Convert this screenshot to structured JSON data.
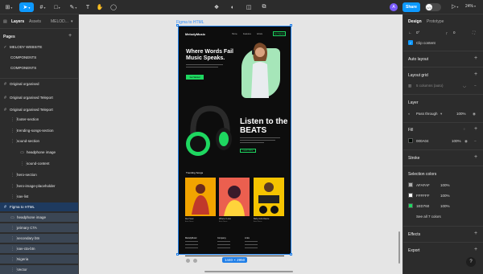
{
  "toolbar": {
    "avatar_initial": "A",
    "share_label": "Share",
    "devmode_icon": "</>",
    "zoom": "24%"
  },
  "left_panel": {
    "tabs": [
      "Layers",
      "Assets",
      "MELOD..."
    ],
    "pages_header": "Pages",
    "pages": [
      "MELODY WEBSITE",
      "COMPONENTS",
      "COMPONENTS"
    ],
    "layers": [
      {
        "label": "Original organised",
        "icon": "#"
      },
      {
        "label": "Original organised Teleport",
        "icon": "#"
      },
      {
        "label": "Original organised Teleport",
        "icon": "#"
      },
      {
        "label": "footer-section",
        "icon": "⋮⋮"
      },
      {
        "label": "trending-songs-section",
        "icon": "⋮⋮"
      },
      {
        "label": "sound-section",
        "icon": "⋮⋮"
      },
      {
        "label": "headphone image",
        "icon": "▭"
      },
      {
        "label": "sound-content",
        "icon": "⋮⋮"
      },
      {
        "label": "hero-section",
        "icon": "⋮⋮"
      },
      {
        "label": "hero-image-placeholder",
        "icon": "⋮⋮"
      },
      {
        "label": "nav-list",
        "icon": "⋮⋮"
      },
      {
        "label": "Figma to HTML",
        "icon": "#"
      },
      {
        "label": "headphone image",
        "icon": "▭"
      },
      {
        "label": "primary CTA",
        "icon": "⋮⋮"
      },
      {
        "label": "secondary btn",
        "icon": "⋮⋮"
      },
      {
        "label": "nav-cta-btn",
        "icon": "⋮⋮"
      },
      {
        "label": "Nigeria",
        "icon": "⋮⋮"
      },
      {
        "label": "Vector",
        "icon": "⋮⋮"
      }
    ]
  },
  "canvas": {
    "frame_label": "Figma to HTML",
    "size_badge": "1440 × 2950",
    "site": {
      "logo": "MelodyMusic",
      "nav_links": [
        "Home",
        "Features",
        "Artists"
      ],
      "nav_cta": "Get Started",
      "hero_title": "Where Words Fail Music Speaks.",
      "hero_btn": "Get Started",
      "beats_title": "Listen to the BEATS",
      "beats_btn": "Learn More",
      "trending": "Trending Songs",
      "cards": [
        {
          "title": "Red Soul",
          "sub": "Artist Name"
        },
        {
          "title": "Where I Love",
          "sub": "Artist Name"
        },
        {
          "title": "Baby Girls Dance",
          "sub": "Artist Name"
        }
      ],
      "footer_cols": [
        "MelodyMusic",
        "Company",
        "Links"
      ]
    }
  },
  "right_panel": {
    "tabs": [
      "Design",
      "Prototype"
    ],
    "rotation": "0°",
    "radius": "0",
    "clip_content": "Clip content",
    "auto_layout": "Auto layout",
    "layout_grid": "Layout grid",
    "layout_grid_value": "5 columns (auto)",
    "layer": "Layer",
    "pass_through": "Pass through",
    "layer_opacity": "100%",
    "fill": "Fill",
    "fill_hex": "000A04",
    "fill_opacity": "100%",
    "stroke": "Stroke",
    "selection_colors": "Selection colors",
    "colors": [
      {
        "hex": "AFAFAF",
        "opacity": "100%",
        "color": "#afafaf"
      },
      {
        "hex": "FFFFFF",
        "opacity": "100%",
        "color": "#ffffff"
      },
      {
        "hex": "1ED760",
        "opacity": "100%",
        "color": "#1ed760"
      }
    ],
    "see_all": "See all 7 colors",
    "effects": "Effects",
    "export": "Export",
    "help": "?"
  }
}
